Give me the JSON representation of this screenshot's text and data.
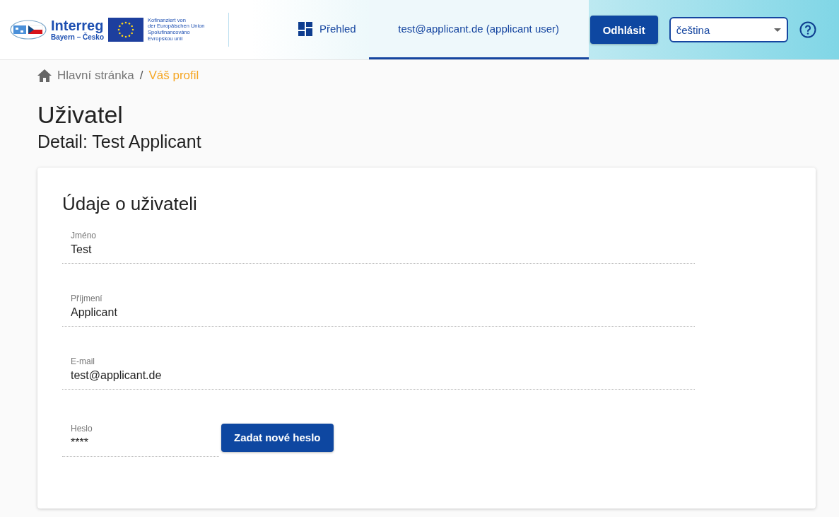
{
  "header": {
    "logo": {
      "name": "Interreg",
      "region": "Bayern – Česko",
      "eu_lines": [
        "Kofinanziert von",
        "der Europäischen Union",
        "Spolufinancováno",
        "Evropskou unií"
      ]
    },
    "nav": [
      {
        "kind": "overview",
        "label": "Přehled",
        "selected": false
      },
      {
        "kind": "user",
        "label": "test@applicant.de (applicant user)",
        "selected": true
      }
    ],
    "logout": "Odhlásit",
    "language": {
      "value": "čeština"
    }
  },
  "breadcrumb_separator": "/",
  "breadcrumb": [
    {
      "label": "Hlavní stránka",
      "current": false
    },
    {
      "label": "Váš profil",
      "current": true
    }
  ],
  "title": "Uživatel",
  "subtitle": "Detail: Test Applicant",
  "card": {
    "title": "Údaje o uživateli",
    "fields": [
      {
        "label": "Jméno",
        "value": "Test"
      },
      {
        "label": "Příjmení",
        "value": "Applicant"
      },
      {
        "label": "E-mail",
        "value": "test@applicant.de"
      },
      {
        "label": "Heslo",
        "value": "****",
        "button": "Zadat nové heslo"
      }
    ]
  }
}
